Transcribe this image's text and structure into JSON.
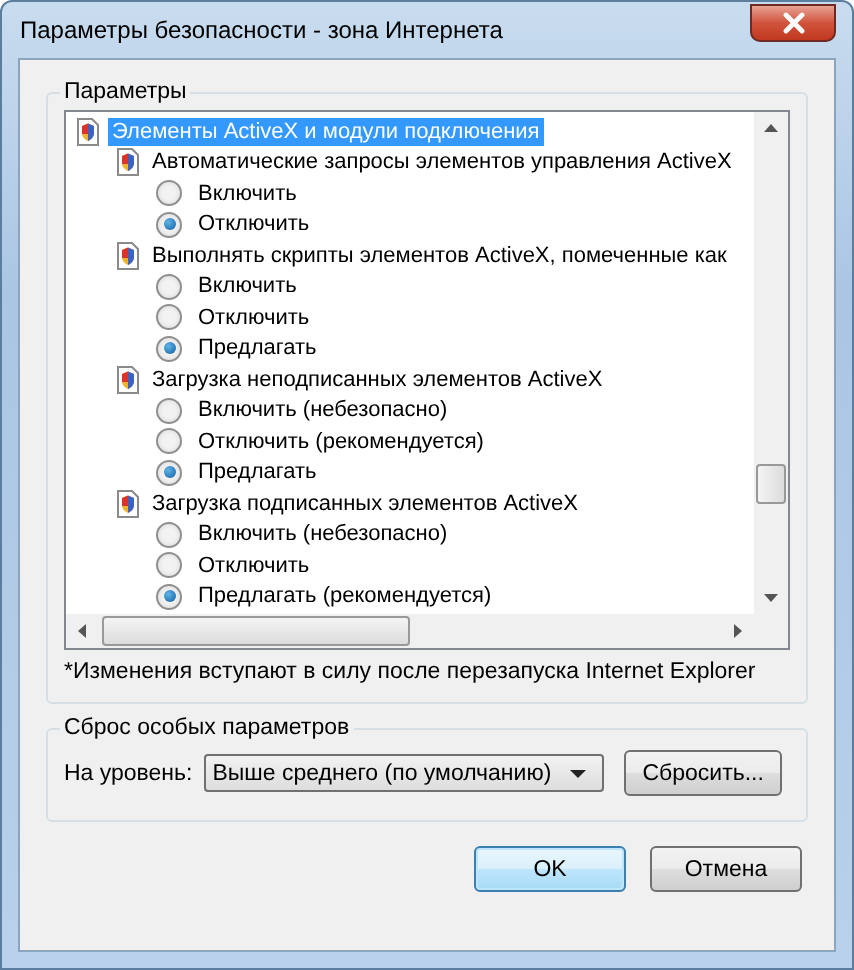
{
  "window": {
    "title": "Параметры безопасности - зона Интернета"
  },
  "settings_group": {
    "title": "Параметры",
    "tree": [
      {
        "label": "Элементы ActiveX и модули подключения",
        "selected": true,
        "children": [
          {
            "label": "Автоматические запросы элементов управления ActiveX",
            "options": [
              {
                "label": "Включить",
                "selected": false
              },
              {
                "label": "Отключить",
                "selected": true
              }
            ]
          },
          {
            "label": "Выполнять скрипты элементов ActiveX, помеченные как",
            "options": [
              {
                "label": "Включить",
                "selected": false
              },
              {
                "label": "Отключить",
                "selected": false
              },
              {
                "label": "Предлагать",
                "selected": true
              }
            ]
          },
          {
            "label": "Загрузка неподписанных элементов ActiveX",
            "options": [
              {
                "label": "Включить (небезопасно)",
                "selected": false
              },
              {
                "label": "Отключить (рекомендуется)",
                "selected": false
              },
              {
                "label": "Предлагать",
                "selected": true
              }
            ]
          },
          {
            "label": "Загрузка подписанных элементов ActiveX",
            "options": [
              {
                "label": "Включить (небезопасно)",
                "selected": false
              },
              {
                "label": "Отключить",
                "selected": false
              },
              {
                "label": "Предлагать (рекомендуется)",
                "selected": true
              }
            ]
          }
        ]
      }
    ],
    "note": "*Изменения вступают в силу после перезапуска Internet Explorer"
  },
  "reset_group": {
    "title": "Сброс особых параметров",
    "level_label": "На уровень:",
    "level_value": "Выше среднего (по умолчанию)",
    "reset_button": "Сбросить..."
  },
  "buttons": [
    "OK",
    "Отмена"
  ]
}
